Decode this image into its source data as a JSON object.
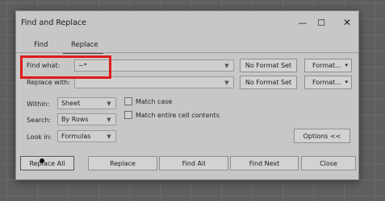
{
  "window": {
    "title": "Find and Replace",
    "minimize_glyph": "—",
    "maximize_glyph": "☐",
    "close_glyph": "✕"
  },
  "tabs": [
    {
      "label": "Find",
      "active": false
    },
    {
      "label": "Replace",
      "active": true
    }
  ],
  "find_what": {
    "label": "Find what:",
    "value": "~*"
  },
  "replace_with": {
    "label": "Replace with:",
    "value": ""
  },
  "format_buttons": {
    "no_format_set": "No Format Set",
    "format": "Format...",
    "caret": "▾"
  },
  "options": {
    "within": {
      "label": "Within:",
      "value": "Sheet"
    },
    "search": {
      "label": "Search:",
      "value": "By Rows"
    },
    "look_in": {
      "label": "Look in:",
      "value": "Formulas"
    },
    "match_case": {
      "label": "Match case",
      "checked": false
    },
    "match_entire": {
      "label": "Match entire cell contents",
      "checked": false
    },
    "options_button": "Options <<"
  },
  "actions": {
    "replace_all": "Replace All",
    "replace": "Replace",
    "find_all": "Find All",
    "find_next": "Find Next",
    "close": "Close"
  },
  "icons": {
    "dropdown": "chevron-down-icon"
  },
  "colors": {
    "highlight": "#e01b1b",
    "dialog_bg": "#c7c7c7"
  }
}
